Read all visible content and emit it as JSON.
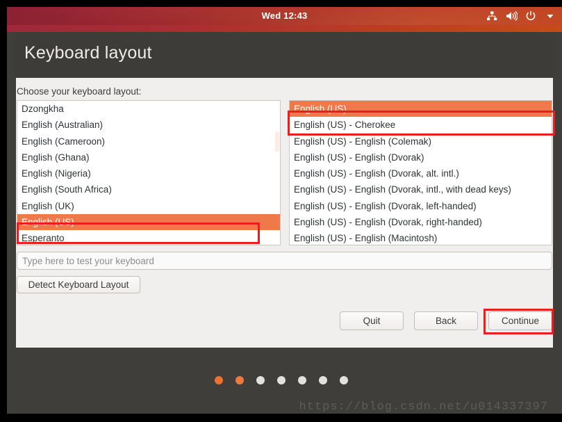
{
  "panel": {
    "clock": "Wed 12:43",
    "indicators": [
      {
        "name": "network-icon",
        "label": "Network"
      },
      {
        "name": "volume-icon",
        "label": "Volume"
      },
      {
        "name": "power-icon",
        "label": "Power"
      },
      {
        "name": "chevron-down-icon",
        "label": "System menu"
      }
    ]
  },
  "window": {
    "title": "Keyboard layout",
    "choose_label": "Choose your keyboard layout:"
  },
  "left_list": {
    "items": [
      "Dzongkha",
      "English (Australian)",
      "English (Cameroon)",
      "English (Ghana)",
      "English (Nigeria)",
      "English (South Africa)",
      "English (UK)",
      "English (US)",
      "Esperanto"
    ],
    "selected_index": 7,
    "selected_value": "English (US)"
  },
  "right_list": {
    "items": [
      "English (US)",
      "English (US) - Cherokee",
      "English (US) - English (Colemak)",
      "English (US) - English (Dvorak)",
      "English (US) - English (Dvorak, alt. intl.)",
      "English (US) - English (Dvorak, intl., with dead keys)",
      "English (US) - English (Dvorak, left-handed)",
      "English (US) - English (Dvorak, right-handed)",
      "English (US) - English (Macintosh)"
    ],
    "selected_index": 0,
    "selected_value": "English (US)"
  },
  "test_input": {
    "placeholder": "Type here to test your keyboard",
    "value": ""
  },
  "buttons": {
    "detect": "Detect Keyboard Layout",
    "quit": "Quit",
    "back": "Back",
    "continue": "Continue"
  },
  "progress_dots": {
    "total": 7,
    "filled": 2,
    "states": [
      "active-a",
      "active-b",
      "inactive",
      "inactive",
      "inactive",
      "inactive",
      "inactive"
    ]
  },
  "watermark": "https://blog.csdn.net/u014337397",
  "colors": {
    "accent_orange": "#ee7a4c",
    "panel_left": "#8a2234",
    "panel_right": "#c0421c",
    "header_dark": "#3d3c38",
    "panel_bg": "#f1efed",
    "annotation_red": "#ee1d1d",
    "dot_active": "#ef6f2c",
    "dot_inactive": "#e3e1df"
  }
}
